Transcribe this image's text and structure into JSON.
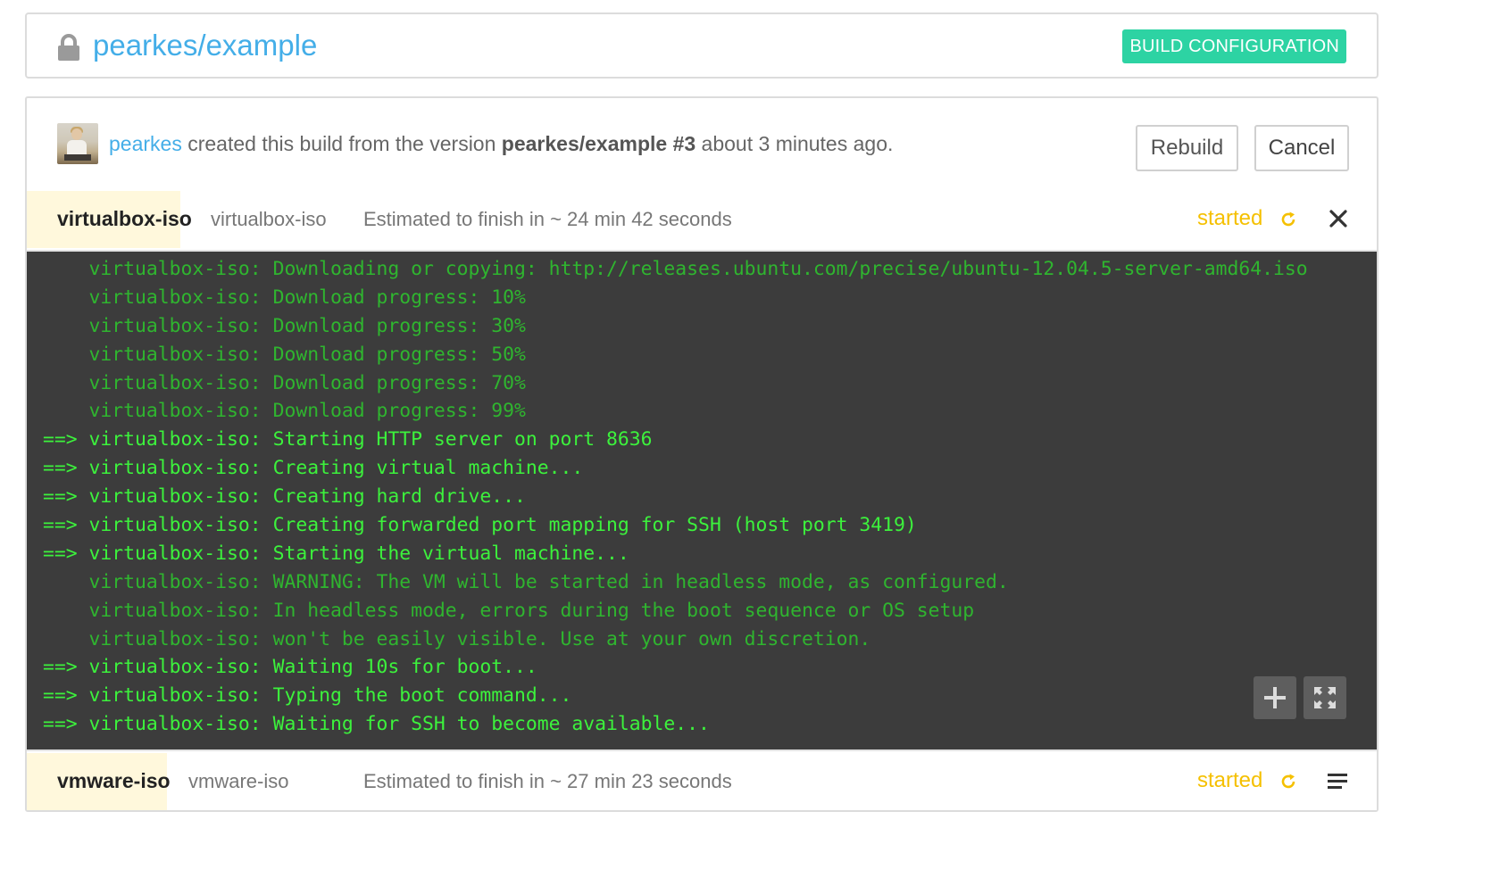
{
  "header": {
    "title": "pearkes/example",
    "build_config_label": "BUILD CONFIGURATION"
  },
  "build_info": {
    "user": "pearkes",
    "text_created": " created this build from the version ",
    "version": "pearkes/example #3",
    "text_time": " about 3 minutes ago.",
    "rebuild_label": "Rebuild",
    "cancel_label": "Cancel"
  },
  "jobs": [
    {
      "name": "virtualbox-iso",
      "type": "virtualbox-iso",
      "estimate": "Estimated to finish in ~ 24 min 42 seconds",
      "status": "started",
      "status_color": "#f5c000",
      "action_icon": "close-icon"
    },
    {
      "name": "vmware-iso",
      "type": "vmware-iso",
      "estimate": "Estimated to finish in ~ 27 min 23 seconds",
      "status": "started",
      "status_color": "#f5c000",
      "action_icon": "menu-icon"
    }
  ],
  "log": {
    "lines": [
      {
        "text": "    virtualbox-iso: Downloading or copying: http://releases.ubuntu.com/precise/ubuntu-12.04.5-server-amd64.iso",
        "style": "dim"
      },
      {
        "text": "    virtualbox-iso: Download progress: 10%",
        "style": "dim"
      },
      {
        "text": "    virtualbox-iso: Download progress: 30%",
        "style": "dim"
      },
      {
        "text": "    virtualbox-iso: Download progress: 50%",
        "style": "dim"
      },
      {
        "text": "    virtualbox-iso: Download progress: 70%",
        "style": "dim"
      },
      {
        "text": "    virtualbox-iso: Download progress: 99%",
        "style": "dim"
      },
      {
        "text": "==> virtualbox-iso: Starting HTTP server on port 8636",
        "style": "bright"
      },
      {
        "text": "==> virtualbox-iso: Creating virtual machine...",
        "style": "bright"
      },
      {
        "text": "==> virtualbox-iso: Creating hard drive...",
        "style": "bright"
      },
      {
        "text": "==> virtualbox-iso: Creating forwarded port mapping for SSH (host port 3419)",
        "style": "bright"
      },
      {
        "text": "==> virtualbox-iso: Starting the virtual machine...",
        "style": "bright"
      },
      {
        "text": "    virtualbox-iso: WARNING: The VM will be started in headless mode, as configured.",
        "style": "dim"
      },
      {
        "text": "    virtualbox-iso: In headless mode, errors during the boot sequence or OS setup",
        "style": "dim"
      },
      {
        "text": "    virtualbox-iso: won't be easily visible. Use at your own discretion.",
        "style": "dim"
      },
      {
        "text": "==> virtualbox-iso: Waiting 10s for boot...",
        "style": "bright"
      },
      {
        "text": "==> virtualbox-iso: Typing the boot command...",
        "style": "bright"
      },
      {
        "text": "==> virtualbox-iso: Waiting for SSH to become available...",
        "style": "bright"
      }
    ],
    "controls": [
      "plus-icon",
      "expand-icon"
    ]
  },
  "colors": {
    "link": "#44aee8",
    "accent": "#2dd3a3",
    "status": "#f5c000",
    "log_bg": "#3c3c3c",
    "log_dim": "#2fb52f",
    "log_bright": "#3cf23c"
  }
}
